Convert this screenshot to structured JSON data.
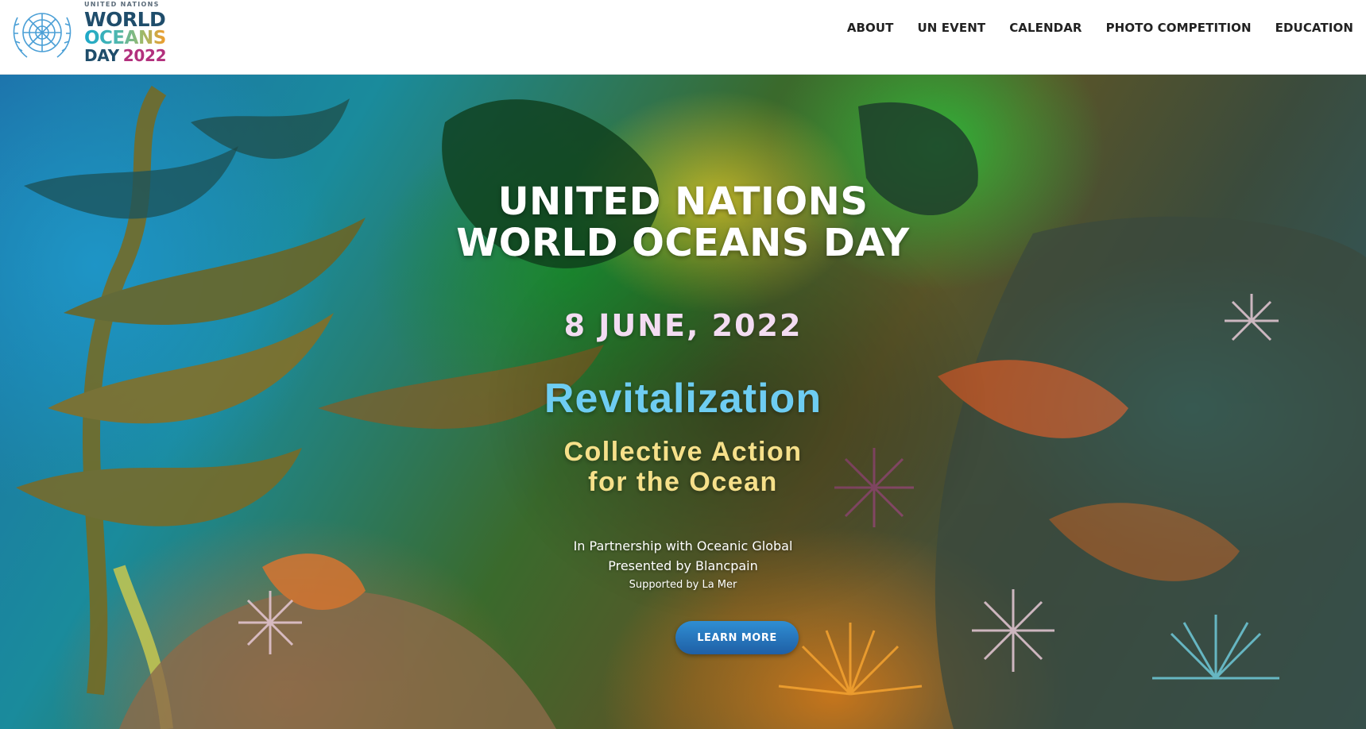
{
  "header": {
    "logo": {
      "small_text": "UNITED NATIONS",
      "line1": "WORLD",
      "line2": "OCEANS",
      "line3_day": "DAY",
      "line3_year": "2022",
      "emblem": "un-emblem-icon"
    },
    "nav": [
      {
        "label": "ABOUT"
      },
      {
        "label": "UN EVENT"
      },
      {
        "label": "CALENDAR"
      },
      {
        "label": "PHOTO COMPETITION"
      },
      {
        "label": "EDUCATION"
      }
    ]
  },
  "hero": {
    "title_line1": "UNITED NATIONS",
    "title_line2": "WORLD OCEANS DAY",
    "date": "8 JUNE, 2022",
    "theme": "Revitalization",
    "subtitle_line1": "Collective Action",
    "subtitle_line2": "for the Ocean",
    "partnership": "In Partnership with Oceanic Global",
    "presented_by": "Presented by Blancpain",
    "supported_by": "Supported by La Mer",
    "cta_label": "LEARN MORE"
  },
  "colors": {
    "title": "#ffffff",
    "date": "#f3dcf2",
    "theme": "#6ecdf2",
    "subtitle": "#f6e08a",
    "cta_background": "#2f8ed3",
    "logo_dark": "#1f4d6b",
    "logo_year": "#b2307d"
  }
}
